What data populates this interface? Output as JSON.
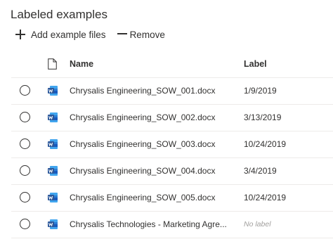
{
  "title": "Labeled examples",
  "toolbar": {
    "add_label": "Add example files",
    "remove_label": "Remove"
  },
  "table": {
    "columns": {
      "name": "Name",
      "label": "Label"
    },
    "rows": [
      {
        "name": "Chrysalis Engineering_SOW_001.docx",
        "label": "1/9/2019"
      },
      {
        "name": "Chrysalis Engineering_SOW_002.docx",
        "label": "3/13/2019"
      },
      {
        "name": "Chrysalis Engineering_SOW_003.docx",
        "label": "10/24/2019"
      },
      {
        "name": "Chrysalis Engineering_SOW_004.docx",
        "label": "3/4/2019"
      },
      {
        "name": "Chrysalis Engineering_SOW_005.docx",
        "label": "10/24/2019"
      },
      {
        "name": "Chrysalis Technologies - Marketing Agre...",
        "label": "",
        "label_placeholder": "No label"
      }
    ]
  },
  "colors": {
    "word_blue": "#2b579a",
    "word_light": "#41a5ee",
    "divider": "#edebe9"
  },
  "icons": {
    "file": "document-icon",
    "word": "word-file-icon",
    "add": "plus-icon",
    "remove": "minus-icon"
  }
}
